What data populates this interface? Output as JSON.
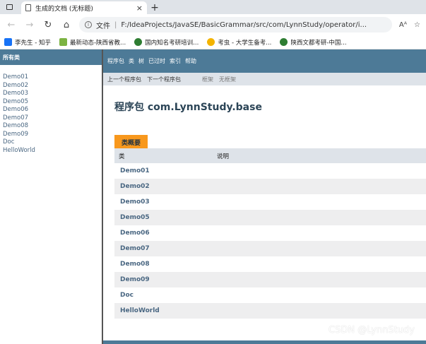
{
  "browser": {
    "tab_title": "生成的文档 (无标题)",
    "close_glyph": "×",
    "newtab_glyph": "+",
    "back_glyph": "←",
    "forward_glyph": "→",
    "reload_glyph": "↻",
    "home_glyph": "⌂",
    "url_prefix": "文件",
    "url_path": "F:/IdeaProjects/JavaSE/BasicGrammar/src/com/LynnStudy/operator/i...",
    "read_aloud": "Aᴬ",
    "favorite_glyph": "☆",
    "bookmarks": [
      {
        "label": "李先生 - 知乎",
        "color": "#1772f6"
      },
      {
        "label": "最新动态-陕西省教...",
        "color": "#7cb342"
      },
      {
        "label": "国内知名考研培训...",
        "color": "#2e7d32"
      },
      {
        "label": "考虫 - 大学生备考...",
        "color": "#f4b400"
      },
      {
        "label": "陕西文都考研-中国...",
        "color": "#2e7d32"
      }
    ]
  },
  "left_frame": {
    "header": "所有类",
    "classes": [
      "Demo01",
      "Demo02",
      "Demo03",
      "Demo05",
      "Demo06",
      "Demo07",
      "Demo08",
      "Demo09",
      "Doc",
      "HelloWorld"
    ]
  },
  "right_frame": {
    "topnav": [
      "程序包",
      "类",
      "树",
      "已过时",
      "索引",
      "帮助"
    ],
    "subnav": {
      "prev": "上一个程序包",
      "next": "下一个程序包",
      "frames": "框架",
      "noframes": "无框架"
    },
    "package_title": "程序包 com.LynnStudy.base",
    "summary_caption": "类概要",
    "col_class": "类",
    "col_desc": "说明",
    "rows": [
      "Demo01",
      "Demo02",
      "Demo03",
      "Demo05",
      "Demo06",
      "Demo07",
      "Demo08",
      "Demo09",
      "Doc",
      "HelloWorld"
    ]
  },
  "watermark": "CSDN @LynnStudy",
  "colors": {
    "nav_bg": "#4d7a97",
    "caption_bg": "#f8981d",
    "header_bg": "#dee3e9",
    "link": "#4a6782"
  }
}
